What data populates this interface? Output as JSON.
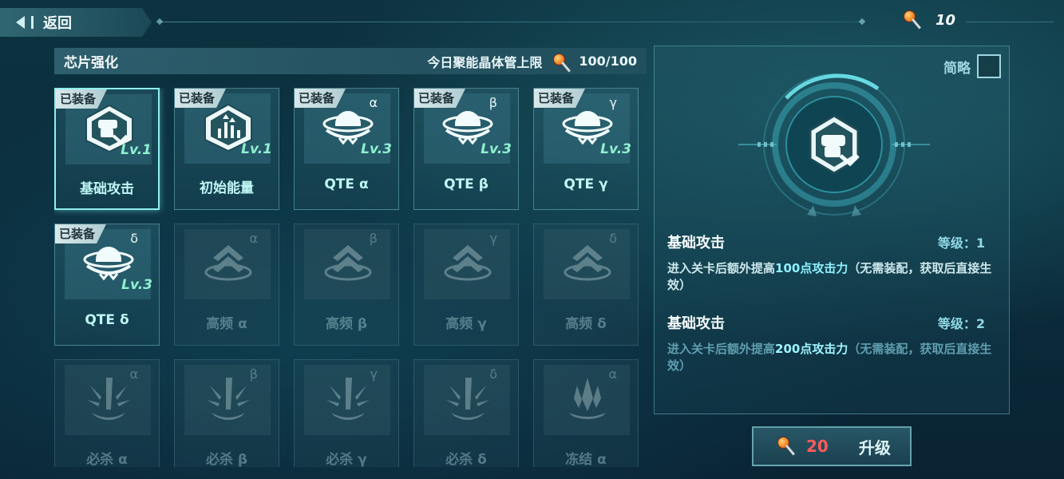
{
  "topbar": {
    "back_label": "返回",
    "currency_value": "10"
  },
  "chip_panel": {
    "title": "芯片强化",
    "limit_label": "今日聚能晶体管上限",
    "limit_value": "100/100"
  },
  "chips": [
    {
      "label": "基础攻击",
      "equipped": "已装备",
      "greek": "",
      "level": "Lv.1",
      "icon": "fist-icon",
      "state": "selected"
    },
    {
      "label": "初始能量",
      "equipped": "已装备",
      "greek": "",
      "level": "Lv.1",
      "icon": "energy-icon",
      "state": "unlocked"
    },
    {
      "label": "QTE α",
      "equipped": "已装备",
      "greek": "α",
      "level": "Lv.3",
      "icon": "qte-orb-icon",
      "state": "unlocked"
    },
    {
      "label": "QTE β",
      "equipped": "已装备",
      "greek": "β",
      "level": "Lv.3",
      "icon": "qte-orb-icon",
      "state": "unlocked"
    },
    {
      "label": "QTE γ",
      "equipped": "已装备",
      "greek": "γ",
      "level": "Lv.3",
      "icon": "qte-orb-icon",
      "state": "unlocked"
    },
    {
      "label": "QTE δ",
      "equipped": "已装备",
      "greek": "δ",
      "level": "Lv.3",
      "icon": "qte-orb-icon",
      "state": "unlocked"
    },
    {
      "label": "高频 α",
      "equipped": "",
      "greek": "α",
      "level": "",
      "icon": "chevron-up-icon",
      "state": "locked"
    },
    {
      "label": "高频 β",
      "equipped": "",
      "greek": "β",
      "level": "",
      "icon": "chevron-up-icon",
      "state": "locked"
    },
    {
      "label": "高频 γ",
      "equipped": "",
      "greek": "γ",
      "level": "",
      "icon": "chevron-up-icon",
      "state": "locked"
    },
    {
      "label": "高频 δ",
      "equipped": "",
      "greek": "δ",
      "level": "",
      "icon": "chevron-up-icon",
      "state": "locked"
    },
    {
      "label": "必杀 α",
      "equipped": "",
      "greek": "α",
      "level": "",
      "icon": "blade-burst-icon",
      "state": "locked"
    },
    {
      "label": "必杀 β",
      "equipped": "",
      "greek": "β",
      "level": "",
      "icon": "blade-burst-icon",
      "state": "locked"
    },
    {
      "label": "必杀 γ",
      "equipped": "",
      "greek": "γ",
      "level": "",
      "icon": "blade-burst-icon",
      "state": "locked"
    },
    {
      "label": "必杀 δ",
      "equipped": "",
      "greek": "δ",
      "level": "",
      "icon": "blade-burst-icon",
      "state": "locked"
    },
    {
      "label": "冻结 α",
      "equipped": "",
      "greek": "α",
      "level": "",
      "icon": "ice-crystal-icon",
      "state": "locked"
    }
  ],
  "detail": {
    "brief_label": "简略",
    "entries": [
      {
        "name": "基础攻击",
        "level_label": "等级：1",
        "desc_pre": "进入关卡后额外提高",
        "desc_hl": "100点攻击力",
        "desc_post": "（无需装配，获取后直接生效）"
      },
      {
        "name": "基础攻击",
        "level_label": "等级：2",
        "desc_pre": "进入关卡后额外提高",
        "desc_hl": "200点攻击力",
        "desc_post": "（无需装配，获取后直接生效）"
      }
    ]
  },
  "upgrade": {
    "cost": "20",
    "label": "升级"
  },
  "colors": {
    "accent": "#8ff0ee",
    "cost_red": "#ff5a5a",
    "level_green": "#8ff0d0"
  }
}
